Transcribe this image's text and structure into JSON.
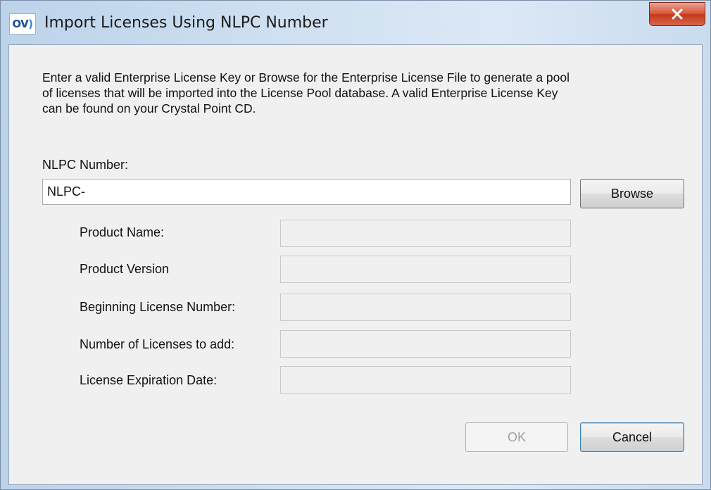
{
  "window": {
    "title": "Import Licenses Using NLPC Number",
    "logo_text_a": "OV",
    "logo_text_b": ")"
  },
  "description": {
    "line1": "Enter a valid Enterprise License Key or Browse for the Enterprise License File to generate a pool",
    "line2": "of licenses that will be imported into the License Pool database. A valid Enterprise License Key",
    "line3": "can be found on your Crystal Point CD."
  },
  "nlpc": {
    "label": "NLPC Number:",
    "value": "NLPC-"
  },
  "buttons": {
    "browse": "Browse",
    "ok": "OK",
    "cancel": "Cancel"
  },
  "fields": [
    {
      "label": "Product Name:",
      "value": ""
    },
    {
      "label": "Product Version",
      "value": ""
    },
    {
      "label": "Beginning License Number:",
      "value": ""
    },
    {
      "label": "Number of Licenses to add:",
      "value": ""
    },
    {
      "label": "License Expiration Date:",
      "value": ""
    }
  ],
  "colors": {
    "close_button": "#d7573a",
    "dialog_background": "#f0f0f0",
    "disabled_text": "#a0a0a0"
  }
}
